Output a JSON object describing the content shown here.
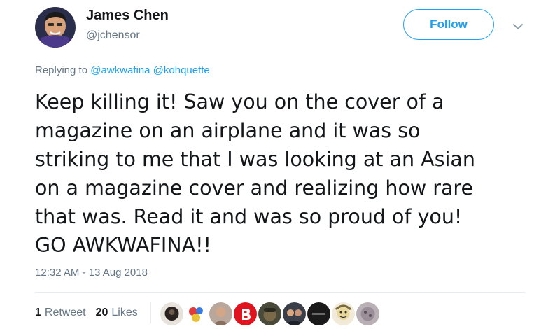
{
  "author": {
    "name": "James Chen",
    "handle": "@jchensor"
  },
  "follow_button": {
    "label": "Follow"
  },
  "menu": {
    "icon": "chevron-down-icon"
  },
  "reply_context": {
    "prefix": "Replying to",
    "mentions": [
      "@awkwafina",
      "@kohquette"
    ]
  },
  "tweet": {
    "lines": [
      "Keep killing it! Saw you on the cover of a",
      "magazine on an airplane and it was so",
      "striking to me that I was looking at an Asian",
      "on a magazine cover and realizing how rare",
      "that was. Read it and was so proud of you!",
      "GO AWKWAFINA!!"
    ],
    "timestamp": "12:32 AM - 13 Aug 2018"
  },
  "stats": {
    "retweets": {
      "count": "1",
      "label": "Retweet"
    },
    "likes": {
      "count": "20",
      "label": "Likes"
    }
  },
  "colors": {
    "accent": "#1da1f2",
    "text": "#14171a",
    "secondary_text": "#657786",
    "divider": "#e6ecf0"
  }
}
